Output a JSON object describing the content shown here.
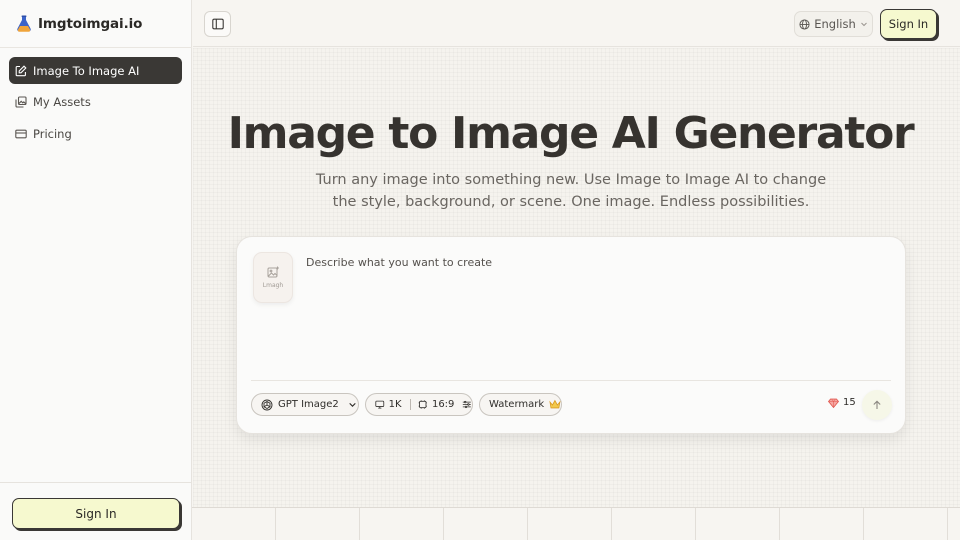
{
  "app": {
    "name": "Imgtoimgai.io"
  },
  "sidebar": {
    "items": [
      {
        "label": "Image To Image AI",
        "icon": "edit-icon",
        "active": true
      },
      {
        "label": "My Assets",
        "icon": "gallery-icon",
        "active": false
      },
      {
        "label": "Pricing",
        "icon": "card-icon",
        "active": false
      }
    ],
    "sign_in_label": "Sign In"
  },
  "topbar": {
    "language": "English",
    "sign_in_label": "Sign In"
  },
  "hero": {
    "title": "Image to Image AI Generator",
    "subtitle": "Turn any image into something new. Use Image to Image AI to change the style, background, or scene. One image. Endless possibilities."
  },
  "generator": {
    "upload_label": "Lmagh",
    "prompt_placeholder": "Describe what you want to create",
    "prompt_value": "",
    "model": "GPT Image2",
    "resolution": "1K",
    "aspect_ratio": "16:9",
    "watermark_label": "Watermark",
    "credits": "15"
  },
  "colors": {
    "accent_yellow": "#f6f9cf",
    "dark": "#3a3835",
    "credit_gem": "#e0524a",
    "crown": "#e8b33a",
    "logo_blue": "#3b63c9"
  }
}
